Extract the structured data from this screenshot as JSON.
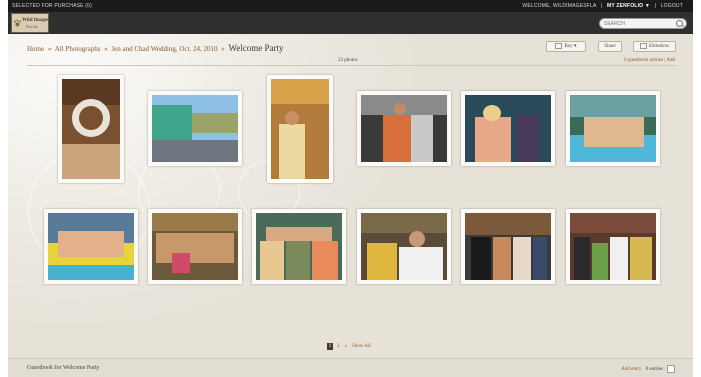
{
  "topbar": {
    "selected": "SELECTED FOR PURCHASE (0)",
    "welcome": "WELCOME, WILDIMAGESFLA",
    "sep": "|",
    "my": "MY ZENFOLIO ▼",
    "logout": "LOGOUT"
  },
  "logo": {
    "line1": "Wild Images",
    "line2": "Florida"
  },
  "search": {
    "placeholder": "SEARCH"
  },
  "breadcrumb": {
    "home": "Home",
    "all": "All Photographs",
    "gallery": "Jen and Chad Wedding, Oct. 24, 2010",
    "sep": "»",
    "current": "Welcome Party"
  },
  "buttons": {
    "buy": "Buy ▾",
    "share": "Share",
    "slideshow": "Slideshow"
  },
  "photo_count": "23 photos",
  "guestbook": {
    "entries": "0 guestbook entries",
    "add": "Add",
    "sep": "|"
  },
  "pager": {
    "current": "1",
    "next": "2",
    "arrow": "»",
    "showall": "Show All"
  },
  "bottom": {
    "label": "Guestbook for Welcome Party",
    "add": "Add entry",
    "count": "0 entries"
  },
  "colors": {
    "link": "#8a5a2b",
    "background": "#e7e2d8",
    "topbar": "#1b1b1b"
  }
}
